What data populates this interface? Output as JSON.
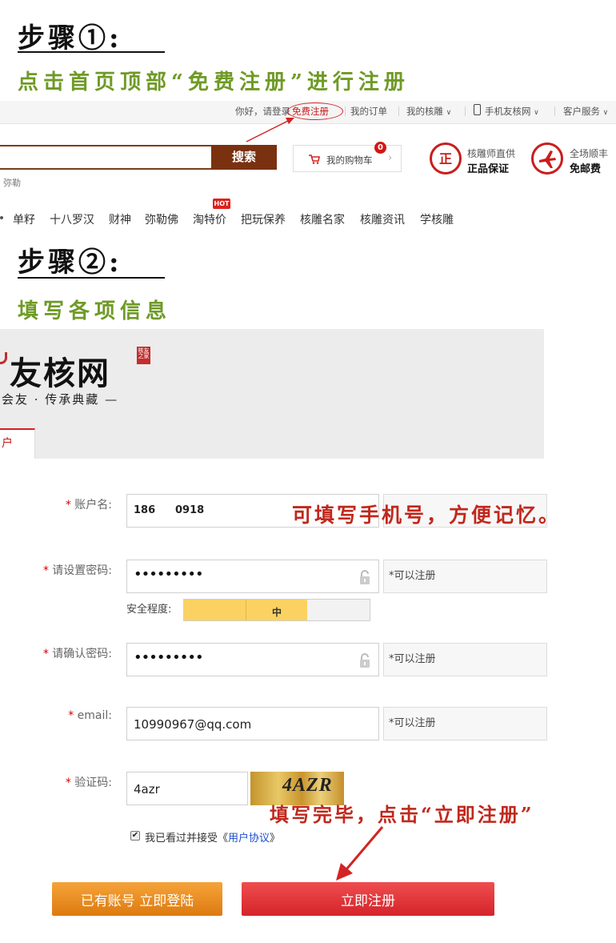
{
  "step1": {
    "title": "步骤①:",
    "desc": "点击首页顶部“免费注册”进行注册"
  },
  "topbar": {
    "greeting": "你好，请登录",
    "register": "免费注册",
    "orders": "我的订单",
    "my_hediao": "我的核雕",
    "mobile": "手机友核网",
    "service": "客户服务"
  },
  "header": {
    "search_button": "搜索",
    "search_hint": "弥勒",
    "cart_label": "我的购物车",
    "cart_count": "0",
    "promo1_line1": "核雕师直供",
    "promo1_line2": "正品保证",
    "promo1_icon_char": "正",
    "promo2_line1": "全场顺丰",
    "promo2_line2": "免邮费"
  },
  "nav": {
    "hot_badge": "HOT",
    "items": [
      "单籽",
      "十八罗汉",
      "财神",
      "弥勒佛",
      "淘特价",
      "把玩保养",
      "核雕名家",
      "核雕资讯",
      "学核雕"
    ]
  },
  "step2": {
    "title": "步骤②:",
    "desc": "填写各项信息"
  },
  "site": {
    "logo": "友核网",
    "seal": "核友之家",
    "tagline": "会友 · 传承典藏 —",
    "tab": "户"
  },
  "form": {
    "required_mark": "*",
    "username_label": "账户名:",
    "username_value": "186",
    "username_value_tail": "0918",
    "password_label": "请设置密码:",
    "password_value": "•••••••••",
    "password_hint": "*可以注册",
    "strength_label": "安全程度:",
    "strength_level": "中",
    "strength_fraction": 0.66,
    "confirm_label": "请确认密码:",
    "confirm_value": "•••••••••",
    "confirm_hint": "*可以注册",
    "email_label": "email:",
    "email_value": "10990967@qq.com",
    "email_hint": "*可以注册",
    "captcha_label": "验证码:",
    "captcha_value": "4azr",
    "captcha_image_text": "4AZR",
    "agree_check": "✔",
    "agree_text": "我已看过并接受《",
    "agree_link": "用户协议",
    "agree_end": "》",
    "login_button": "已有账号 立即登陆",
    "register_button": "立即注册"
  },
  "annotations": {
    "phone_tip": "可填写手机号，方便记忆。",
    "submit_tip": "填写完毕，点击“立即注册”"
  },
  "colors": {
    "step_green": "#6f9a26",
    "annotation_red": "#c0281c",
    "search_brown": "#7a3110",
    "register_red": "#d4242a",
    "login_orange": "#dd7a10"
  }
}
